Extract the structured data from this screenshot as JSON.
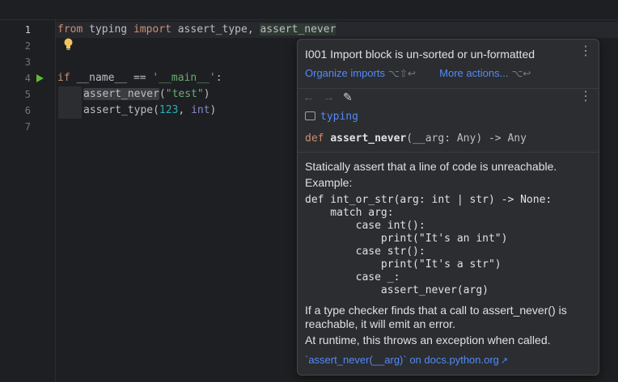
{
  "editor": {
    "line_numbers": [
      "1",
      "2",
      "3",
      "4",
      "5",
      "6",
      "7"
    ],
    "lines": {
      "l1": {
        "t0": "from",
        "t1": " typing ",
        "t2": "import",
        "t3": " assert_type, ",
        "t4": "assert_never"
      },
      "l4": {
        "t0": "if",
        "t1": " __name__ ",
        "t2": "==",
        "t3": " ",
        "t4": "'__main__'",
        "t5": ":"
      },
      "l5": {
        "t0": "assert_never",
        "t1": "(",
        "t2": "\"test\"",
        "t3": ")"
      },
      "l6": {
        "t0": "assert_type",
        "t1": "(",
        "t2": "123",
        "t3": ", ",
        "t4": "int",
        "t5": ")"
      }
    }
  },
  "popup": {
    "title": "I001 Import block is un-sorted or un-formatted",
    "menu_icon": "more-vertical-icon",
    "action_organize": "Organize imports",
    "shortcut_organize": "⌥⇧↩",
    "action_more": "More actions...",
    "shortcut_more": "⌥↩",
    "module": "typing",
    "signature": {
      "def": "def ",
      "name": "assert_never",
      "rest": "(__arg: Any) -> Any"
    },
    "description": "Statically assert that a line of code is unreachable. Example:",
    "code_example": "def int_or_str(arg: int | str) -> None:\n    match arg:\n        case int():\n            print(\"It's an int\")\n        case str():\n            print(\"It's a str\")\n        case _:\n            assert_never(arg)",
    "description2": "If a type checker finds that a call to assert_never() is reachable, it will emit an error.",
    "description3": "At runtime, this throws an exception when called.",
    "doc_link": "`assert_never(__arg)` on docs.python.org",
    "doc_link_icon": "↗"
  }
}
